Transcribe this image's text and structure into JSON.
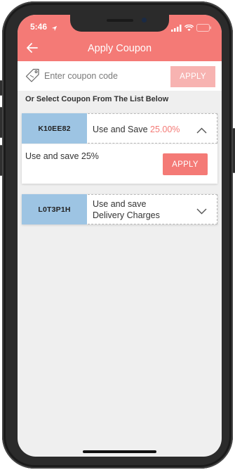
{
  "status_bar": {
    "time": "5:46"
  },
  "header": {
    "title": "Apply Coupon"
  },
  "coupon_entry": {
    "placeholder": "Enter coupon code",
    "apply_label": "APPLY"
  },
  "hint": "Or Select Coupon From The List Below",
  "coupons": [
    {
      "code": "K10EE82",
      "desc_prefix": "Use and Save",
      "desc_value": "25.00%",
      "expanded": true,
      "body_text": "Use and save 25%",
      "apply_label": "APPLY"
    },
    {
      "code": "L0T3P1H",
      "desc_line1": "Use and save",
      "desc_line2": "Delivery Charges",
      "expanded": false
    }
  ],
  "colors": {
    "accent": "#f47a76",
    "accent_light": "#f7b3b1",
    "code_bg": "#9dc4e3"
  }
}
